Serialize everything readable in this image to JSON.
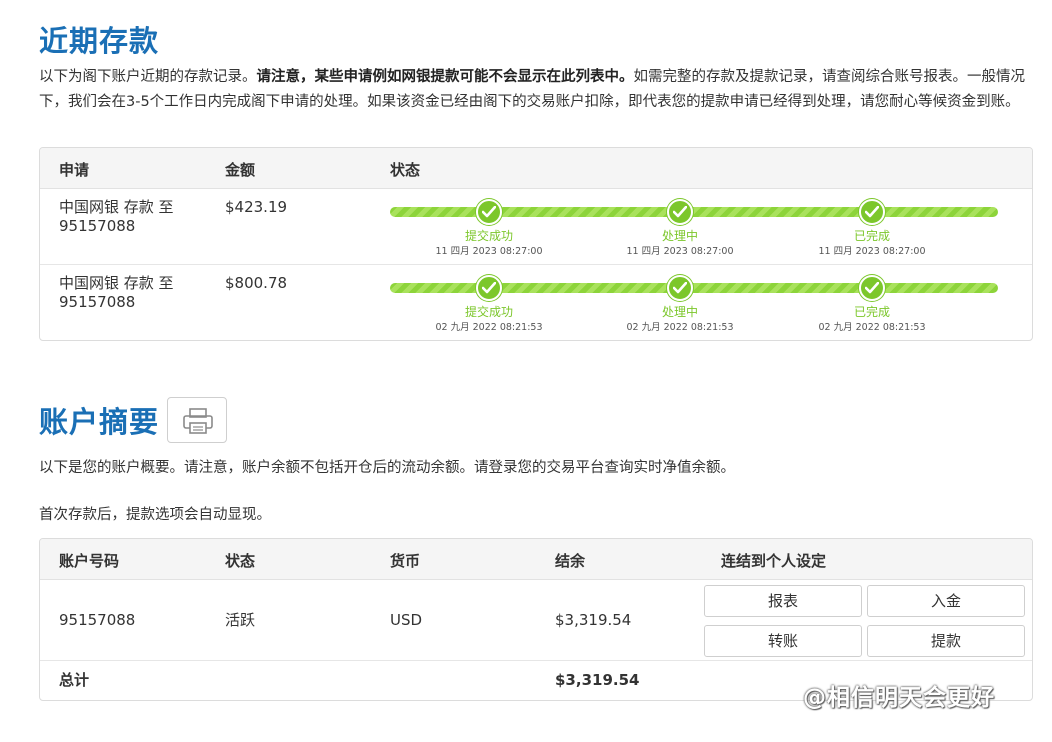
{
  "deposits": {
    "title": "近期存款",
    "intro_part1": "以下为阁下账户近期的存款记录。",
    "intro_bold": "请注意，某些申请例如网银提款可能不会显示在此列表中。",
    "intro_part2": "如需完整的存款及提款记录，请查阅综合账号报表。一般情况下，我们会在3-5个工作日内完成阁下申请的处理。如果该资金已经由阁下的交易账户扣除，即代表您的提款申请已经得到处理，请您耐心等候资金到账。",
    "headers": [
      "申请",
      "金额",
      "状态"
    ],
    "rows": [
      {
        "request": "中国网银 存款 至 95157088",
        "amount": "$423.19",
        "progress": 1.0,
        "steps": [
          {
            "label": "提交成功",
            "time": "11 四月 2023 08:27:00"
          },
          {
            "label": "处理中",
            "time": "11 四月 2023 08:27:00"
          },
          {
            "label": "已完成",
            "time": "11 四月 2023 08:27:00"
          }
        ]
      },
      {
        "request": "中国网银 存款 至 95157088",
        "amount": "$800.78",
        "progress": 1.0,
        "steps": [
          {
            "label": "提交成功",
            "time": "02 九月 2022 08:21:53"
          },
          {
            "label": "处理中",
            "time": "02 九月 2022 08:21:53"
          },
          {
            "label": "已完成",
            "time": "02 九月 2022 08:21:53"
          }
        ]
      }
    ]
  },
  "summary": {
    "title": "账户摘要",
    "print_icon": "printer-icon",
    "note1": "以下是您的账户概要。请注意，账户余额不包括开仓后的流动余额。请登录您的交易平台查询实时净值余额。",
    "note2": "首次存款后，提款选项会自动显现。",
    "headers": [
      "账户号码",
      "状态",
      "货币",
      "结余",
      "连结到个人设定"
    ],
    "account": {
      "number": "95157088",
      "status": "活跃",
      "currency": "USD",
      "balance": "$3,319.54",
      "buttons": [
        "报表",
        "入金",
        "转账",
        "提款"
      ]
    },
    "total_label": "总计",
    "total_value": "$3,319.54"
  },
  "watermark": "@相信明天会更好",
  "colors": {
    "accent": "#1a6fb5",
    "progress": "#7cc72b"
  }
}
